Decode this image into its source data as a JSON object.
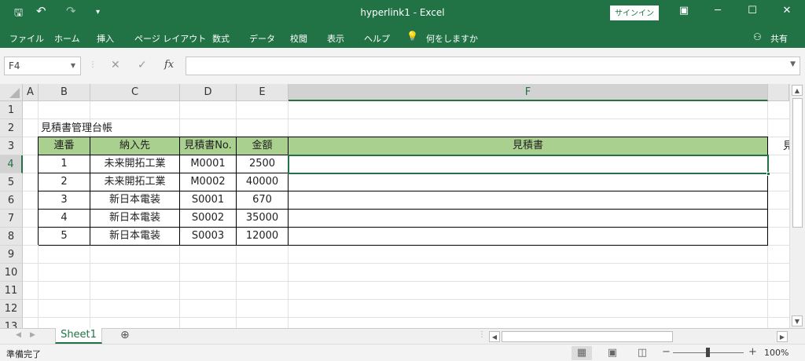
{
  "window": {
    "title": "hyperlink1  -  Excel",
    "signin_label": "サインイン",
    "minimize": "─",
    "maximize": "☐",
    "close": "✕",
    "restore_icon": "▣"
  },
  "quick_access": {
    "save_glyph": "🖫",
    "undo_glyph": "↶",
    "redo_glyph": "↷",
    "customize_glyph": "▾"
  },
  "ribbon": {
    "tabs": [
      "ファイル",
      "ホーム",
      "挿入",
      "ページ レイアウト",
      "数式",
      "データ",
      "校閲",
      "表示",
      "ヘルプ"
    ],
    "tell_me_icon": "💡",
    "tell_me": "何をしますか",
    "share": "共有"
  },
  "formula_bar": {
    "name_box": "F4",
    "cancel": "✕",
    "enter": "✓",
    "fx": "fx",
    "value": ""
  },
  "grid": {
    "columns": [
      "A",
      "B",
      "C",
      "D",
      "E",
      "F"
    ],
    "rows": [
      "1",
      "2",
      "3",
      "4",
      "5",
      "6",
      "7",
      "8",
      "9",
      "10",
      "11",
      "12",
      "13"
    ],
    "selected_column": "F",
    "selected_row": "4",
    "partial_g3": "見"
  },
  "sheet": {
    "title": "見積書管理台帳",
    "headers": [
      "連番",
      "納入先",
      "見積書No.",
      "金額",
      "見積書"
    ],
    "rows": [
      [
        "1",
        "未来開拓工業",
        "M0001",
        "2500",
        ""
      ],
      [
        "2",
        "未来開拓工業",
        "M0002",
        "40000",
        ""
      ],
      [
        "3",
        "新日本電装",
        "S0001",
        "670",
        ""
      ],
      [
        "4",
        "新日本電装",
        "S0002",
        "35000",
        ""
      ],
      [
        "5",
        "新日本電装",
        "S0003",
        "12000",
        ""
      ]
    ]
  },
  "tabs_bar": {
    "sheet_tab": "Sheet1",
    "add_sheet": "⊕"
  },
  "status": {
    "ready": "準備完了",
    "zoom": "100%",
    "zoom_minus": "−",
    "zoom_plus": "+"
  },
  "colors": {
    "accent": "#217346",
    "header_fill": "#a9d08e"
  }
}
